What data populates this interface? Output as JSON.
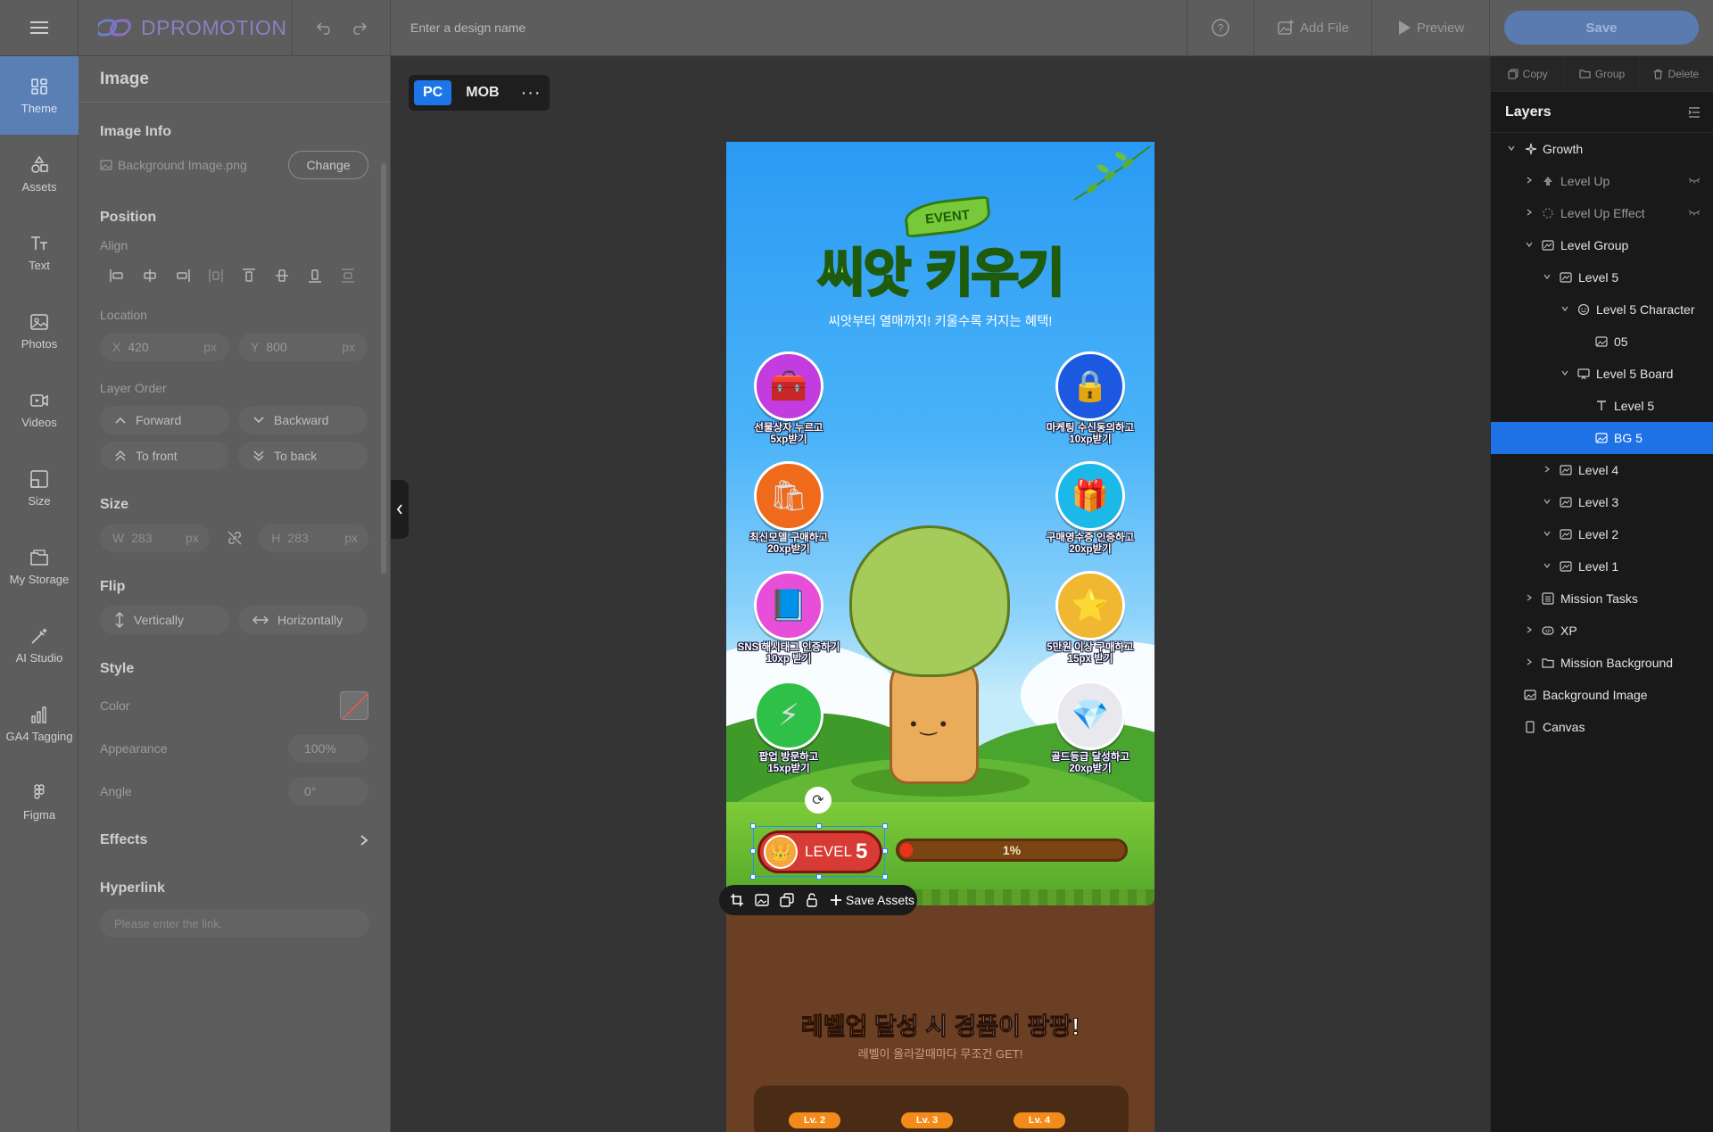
{
  "app": {
    "logo_text": "DPROMOTION",
    "design_name_placeholder": "Enter a design name",
    "add_file_label": "Add File",
    "preview_label": "Preview",
    "save_label": "Save"
  },
  "rail": {
    "items": [
      {
        "label": "Theme",
        "icon": "theme-icon",
        "active": true
      },
      {
        "label": "Assets",
        "icon": "assets-icon"
      },
      {
        "label": "Text",
        "icon": "text-icon"
      },
      {
        "label": "Photos",
        "icon": "photos-icon"
      },
      {
        "label": "Videos",
        "icon": "videos-icon"
      },
      {
        "label": "Size",
        "icon": "size-icon"
      },
      {
        "label": "My Storage",
        "icon": "storage-icon"
      },
      {
        "label": "AI Studio",
        "icon": "ai-studio-icon"
      },
      {
        "label": "GA4 Tagging",
        "icon": "ga4-icon"
      },
      {
        "label": "Figma",
        "icon": "figma-icon"
      }
    ]
  },
  "props": {
    "title": "Image",
    "image_info_heading": "Image Info",
    "file_name": "Background Image.png",
    "change_label": "Change",
    "position_heading": "Position",
    "align_label": "Align",
    "location_label": "Location",
    "x_label": "X",
    "x_value": "420",
    "y_label": "Y",
    "y_value": "800",
    "unit": "px",
    "layer_order_label": "Layer Order",
    "forward_label": "Forward",
    "backward_label": "Backward",
    "to_front_label": "To front",
    "to_back_label": "To back",
    "size_heading": "Size",
    "w_label": "W",
    "w_value": "283",
    "h_label": "H",
    "h_value": "283",
    "flip_heading": "Flip",
    "vertically_label": "Vertically",
    "horizontally_label": "Horizontally",
    "style_heading": "Style",
    "color_label": "Color",
    "appearance_label": "Appearance",
    "appearance_value": "100%",
    "angle_label": "Angle",
    "angle_value": "0°",
    "effects_heading": "Effects",
    "hyperlink_heading": "Hyperlink",
    "hyperlink_placeholder": "Please enter the link."
  },
  "canvas": {
    "device_pc": "PC",
    "device_mob": "MOB",
    "more": "···"
  },
  "artboard": {
    "event_badge": "EVENT",
    "title": "씨앗 키우기",
    "subtitle": "씨앗부터 열매까지! 키울수록 커지는 혜택!",
    "missions_left": [
      {
        "label_1": "선물상자 누르고",
        "label_2": "5xp받기",
        "glyph": "🧰",
        "color": "#c23ce0"
      },
      {
        "label_1": "최신모델 구매하고",
        "label_2": "20xp받기",
        "glyph": "🛍",
        "color": "#f06a1c"
      },
      {
        "label_1": "SNS 해시태그 인증하기",
        "label_2": "10xp 받기",
        "glyph": "📘",
        "color": "#e84fd8"
      },
      {
        "label_1": "팝업 방문하고",
        "label_2": "15xp받기",
        "glyph": "⚡",
        "color": "#2fc04a"
      }
    ],
    "missions_right": [
      {
        "label_1": "마케팅 수신동의하고",
        "label_2": "10xp받기",
        "glyph": "🔒",
        "color": "#1c58e0"
      },
      {
        "label_1": "구매영수증 인증하고",
        "label_2": "20xp받기",
        "glyph": "🎁",
        "color": "#1cb8e8"
      },
      {
        "label_1": "5만원 이상 구매하고",
        "label_2": "15px 받기",
        "glyph": "⭐",
        "color": "#f0b830"
      },
      {
        "label_1": "골드등급 달성하고",
        "label_2": "20xp받기",
        "glyph": "💎",
        "color": "#e8e8ee"
      }
    ],
    "level_label": "LEVEL",
    "level_number": "5",
    "progress_text": "1%",
    "progress_fraction": 0.04,
    "reward_title_highlight": "레벨업",
    "reward_title_rest": " 달성 시 경품이 팡팡!",
    "reward_sub": "레벨이 올라갈때마다 무조건 GET!",
    "level_chips": [
      "Lv. 2",
      "Lv. 3",
      "Lv. 4"
    ]
  },
  "asset_bar": {
    "save_assets_label": "Save Assets"
  },
  "right_panel": {
    "copy_label": "Copy",
    "group_label": "Group",
    "delete_label": "Delete",
    "layers_heading": "Layers",
    "layers": [
      {
        "label": "Growth",
        "indent": 0,
        "chev": "v",
        "icon": "sparkle-icon"
      },
      {
        "label": "Level Up",
        "indent": 1,
        "chev": ">",
        "icon": "arrow-up-icon",
        "dim": true,
        "hidden": true
      },
      {
        "label": "Level Up Effect",
        "indent": 1,
        "chev": ">",
        "icon": "effect-icon",
        "dim": true,
        "hidden": true
      },
      {
        "label": "Level Group",
        "indent": 1,
        "chev": "v",
        "icon": "frame-icon"
      },
      {
        "label": "Level 5",
        "indent": 2,
        "chev": "v",
        "icon": "frame-icon"
      },
      {
        "label": "Level 5 Character",
        "indent": 3,
        "chev": "v",
        "icon": "character-icon"
      },
      {
        "label": "05",
        "indent": 4,
        "chev": "",
        "icon": "image-icon"
      },
      {
        "label": "Level 5 Board",
        "indent": 3,
        "chev": "v",
        "icon": "board-icon"
      },
      {
        "label": "Level 5",
        "indent": 4,
        "chev": "",
        "icon": "text-icon"
      },
      {
        "label": "BG 5",
        "indent": 4,
        "chev": "",
        "icon": "image-icon",
        "selected": true
      },
      {
        "label": "Level 4",
        "indent": 2,
        "chev": ">",
        "icon": "frame-icon"
      },
      {
        "label": "Level 3",
        "indent": 2,
        "chev": "v",
        "icon": "frame-icon"
      },
      {
        "label": "Level 2",
        "indent": 2,
        "chev": "v",
        "icon": "frame-icon"
      },
      {
        "label": "Level 1",
        "indent": 2,
        "chev": "v",
        "icon": "frame-icon"
      },
      {
        "label": "Mission Tasks",
        "indent": 1,
        "chev": ">",
        "icon": "list-icon"
      },
      {
        "label": "XP",
        "indent": 1,
        "chev": ">",
        "icon": "xp-icon"
      },
      {
        "label": "Mission Background",
        "indent": 1,
        "chev": ">",
        "icon": "folder-icon"
      },
      {
        "label": "Background Image",
        "indent": 0,
        "chev": "",
        "icon": "image-icon"
      },
      {
        "label": "Canvas",
        "indent": 0,
        "chev": "",
        "icon": "canvas-icon"
      }
    ]
  }
}
